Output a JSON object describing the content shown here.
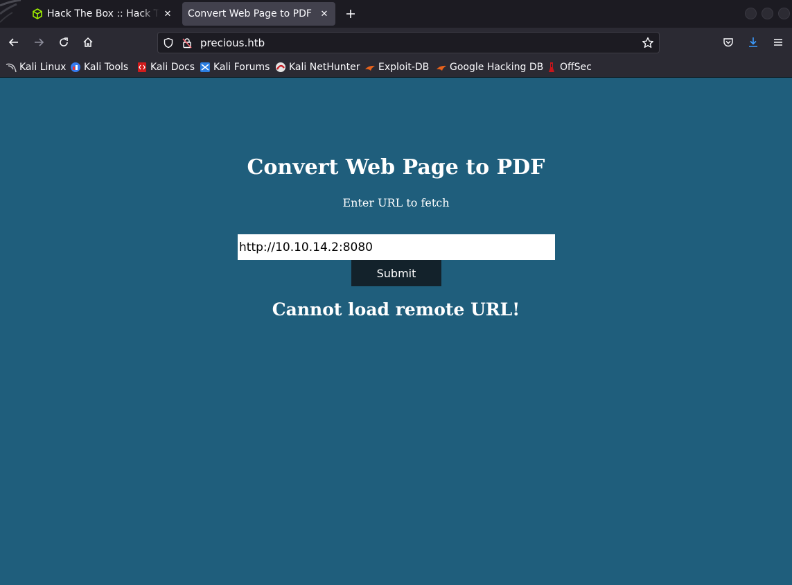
{
  "browser": {
    "tabs": [
      {
        "title": "Hack The Box :: Hack The Box",
        "icon": "hackthebox-cube-icon"
      },
      {
        "title": "Convert Web Page to PDF",
        "icon": "none"
      }
    ],
    "url": "precious.htb",
    "bookmarks": [
      {
        "label": "Kali Linux",
        "icon": "kali-dragon-icon"
      },
      {
        "label": "Kali Tools",
        "icon": "kali-tools-icon"
      },
      {
        "label": "Kali Docs",
        "icon": "kali-docs-icon"
      },
      {
        "label": "Kali Forums",
        "icon": "kali-forums-icon"
      },
      {
        "label": "Kali NetHunter",
        "icon": "nethunter-icon"
      },
      {
        "label": "Exploit-DB",
        "icon": "exploit-db-icon"
      },
      {
        "label": "Google Hacking DB",
        "icon": "ghdb-icon"
      },
      {
        "label": "OffSec",
        "icon": "offsec-icon"
      }
    ]
  },
  "page": {
    "title": "Convert Web Page to PDF",
    "subtitle": "Enter URL to fetch",
    "url_value": "http://10.10.14.2:8080",
    "submit_label": "Submit",
    "error": "Cannot load remote URL!"
  },
  "colors": {
    "page_background": "#1f5e7c",
    "button_background": "#13222b",
    "browser_chrome": "#2b2a33",
    "tab_strip": "#1c1b22"
  }
}
